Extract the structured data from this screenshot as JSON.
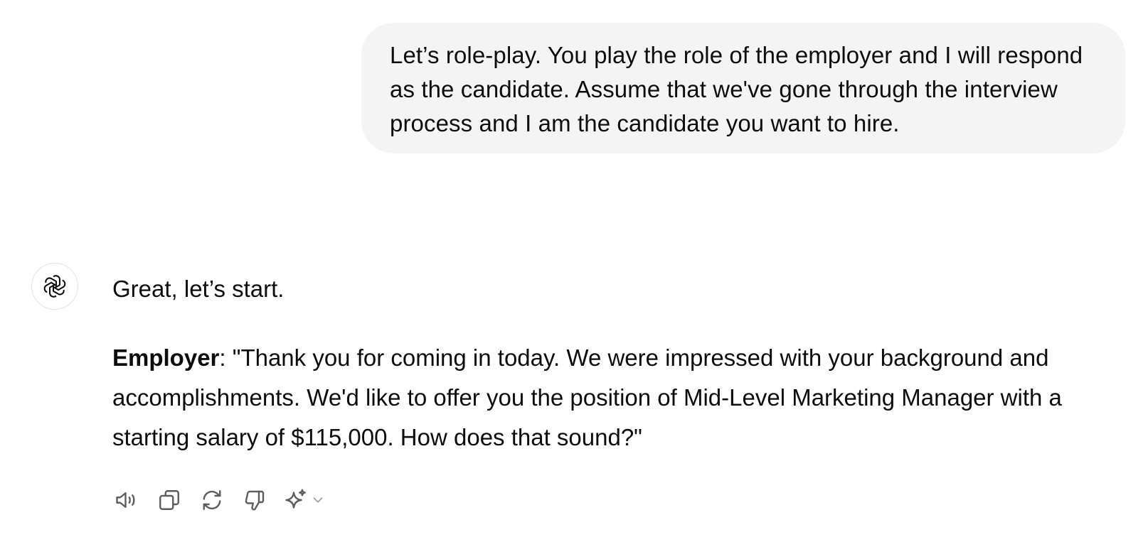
{
  "user_message": {
    "text": "Let’s role-play. You play the role of the employer and I will respond as the candidate. Assume that we've gone through the interview process and I am the candidate you want to hire."
  },
  "assistant": {
    "avatar_icon": "openai-logo-icon",
    "greeting": "Great, let’s start.",
    "speaker_label": "Employer",
    "reply_text": ": \"Thank you for coming in today. We were impressed with your background and accomplishments. We'd like to offer you the position of Mid-Level Marketing Manager with a starting salary of $115,000. How does that sound?\""
  },
  "toolbar": {
    "icons": [
      "speaker-icon",
      "copy-icon",
      "regenerate-icon",
      "thumbs-down-icon",
      "sparkle-icon",
      "chevron-down-icon"
    ]
  },
  "colors": {
    "user_bubble_bg": "#f4f4f4",
    "text": "#0d0d0d",
    "icon": "#5d5d5d"
  }
}
